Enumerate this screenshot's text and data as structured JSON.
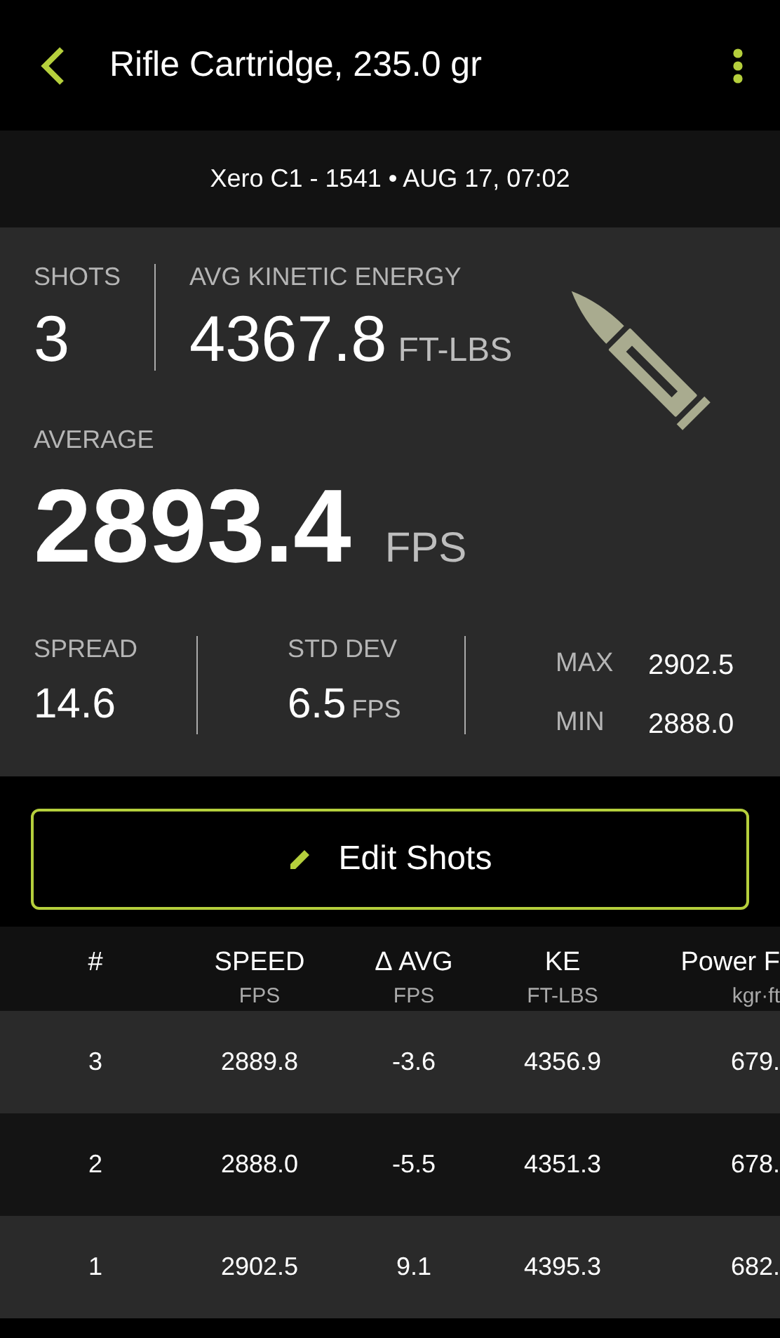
{
  "app_bar": {
    "title": "Rifle Cartridge, 235.0 gr"
  },
  "subtitle": "Xero C1 - 1541 • AUG 17, 07:02",
  "summary": {
    "shots": {
      "label": "SHOTS",
      "value": "3"
    },
    "kinetic_energy": {
      "label": "AVG KINETIC ENERGY",
      "value": "4367.8",
      "unit": "FT-LBS"
    },
    "average": {
      "label": "AVERAGE",
      "value": "2893.4",
      "unit": "FPS"
    },
    "spread": {
      "label": "SPREAD",
      "value": "14.6"
    },
    "std_dev": {
      "label": "STD DEV",
      "value": "6.5",
      "unit": "FPS"
    },
    "max": {
      "label": "MAX",
      "value": "2902.5"
    },
    "min": {
      "label": "MIN",
      "value": "2888.0"
    }
  },
  "edit_button": "Edit Shots",
  "table": {
    "columns": [
      {
        "label": "#"
      },
      {
        "label": "SPEED",
        "unit": "FPS"
      },
      {
        "label": "Δ AVG",
        "unit": "FPS"
      },
      {
        "label": "KE",
        "unit": "FT-LBS"
      },
      {
        "label": "Power F",
        "unit": "kgr·ft"
      }
    ],
    "rows": [
      [
        "3",
        "2889.8",
        "-3.6",
        "4356.9",
        "679."
      ],
      [
        "2",
        "2888.0",
        "-5.5",
        "4351.3",
        "678."
      ],
      [
        "1",
        "2902.5",
        "9.1",
        "4395.3",
        "682."
      ]
    ]
  }
}
